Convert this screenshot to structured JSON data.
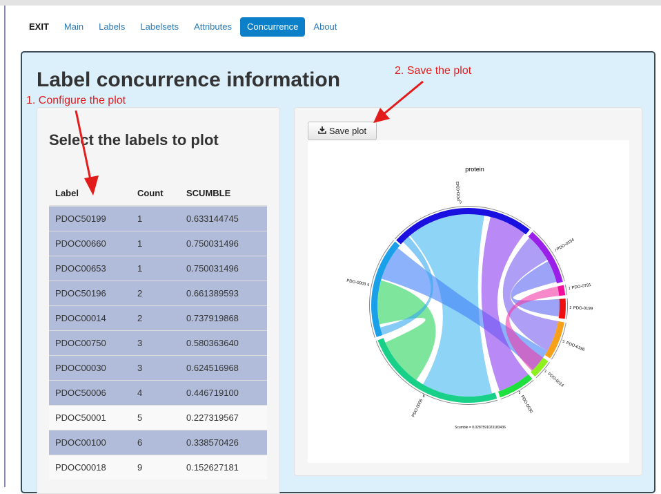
{
  "nav": {
    "exit": "EXIT",
    "items": [
      "Main",
      "Labels",
      "Labelsets",
      "Attributes",
      "Concurrence",
      "About"
    ],
    "active_index": 4
  },
  "page_title": "Label concurrence information",
  "left_panel": {
    "subtitle": "Select the labels to plot",
    "headers": [
      "Label",
      "Count",
      "SCUMBLE"
    ],
    "rows": [
      {
        "label": "PDOC50199",
        "count": "1",
        "scumble": "0.633144745",
        "selected": true
      },
      {
        "label": "PDOC00660",
        "count": "1",
        "scumble": "0.750031496",
        "selected": true
      },
      {
        "label": "PDOC00653",
        "count": "1",
        "scumble": "0.750031496",
        "selected": true
      },
      {
        "label": "PDOC50196",
        "count": "2",
        "scumble": "0.661389593",
        "selected": true
      },
      {
        "label": "PDOC00014",
        "count": "2",
        "scumble": "0.737919868",
        "selected": true
      },
      {
        "label": "PDOC00750",
        "count": "3",
        "scumble": "0.580363640",
        "selected": true
      },
      {
        "label": "PDOC00030",
        "count": "3",
        "scumble": "0.624516968",
        "selected": true
      },
      {
        "label": "PDOC50006",
        "count": "4",
        "scumble": "0.446719100",
        "selected": true
      },
      {
        "label": "PDOC50001",
        "count": "5",
        "scumble": "0.227319567",
        "selected": false
      },
      {
        "label": "PDOC00100",
        "count": "6",
        "scumble": "0.338570426",
        "selected": true
      },
      {
        "label": "PDOC00018",
        "count": "9",
        "scumble": "0.152627181",
        "selected": false
      }
    ]
  },
  "right_panel": {
    "save_button": "Save plot",
    "save_icon": "download-icon"
  },
  "plot": {
    "title": "protein",
    "footer": "Scumble = 0.0287591023183436",
    "sectors": [
      {
        "name": "PDO-0343",
        "tick": "9",
        "color": "#1a10e0"
      },
      {
        "name": "PDO-0154",
        "tick": "7",
        "color": "#9a1fe8"
      },
      {
        "name": "PDO-0791",
        "tick": "1",
        "color": "#f0109a"
      },
      {
        "name": "PDO-0199",
        "tick": "2",
        "color": "#ee1010"
      },
      {
        "name": "PDO-0196",
        "tick": "3",
        "color": "#f7a01a"
      },
      {
        "name": "PDO-0014",
        "tick": "2",
        "color": "#8ef01c"
      },
      {
        "name": "PDO-0030",
        "tick": "3",
        "color": "#20e040"
      },
      {
        "name": "PDO-0006",
        "tick": "8",
        "color": "#18d088"
      },
      {
        "name": "PDO-0003",
        "tick": "9",
        "color": "#1aa0e8"
      }
    ]
  },
  "annotations": {
    "configure": "1. Configure the plot",
    "save": "2. Save the plot"
  }
}
